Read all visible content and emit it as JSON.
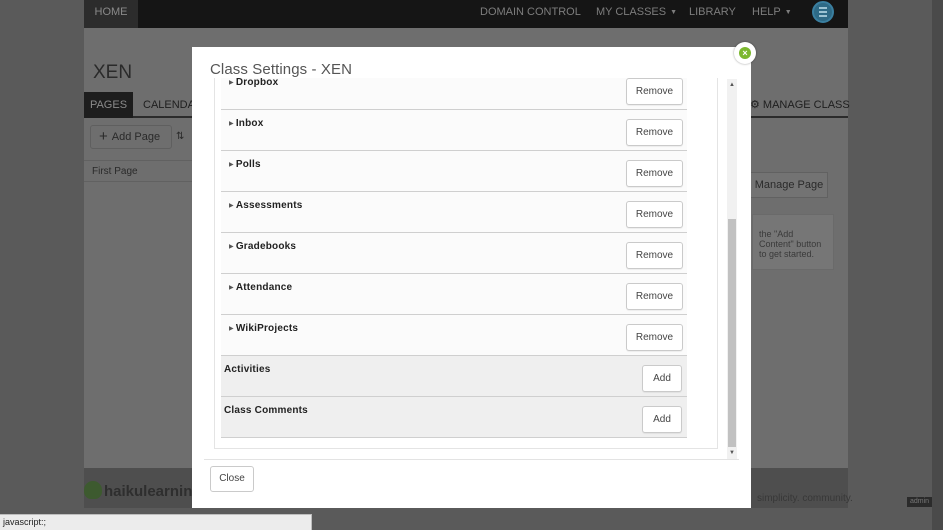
{
  "background": {
    "topnav": {
      "home": "HOME",
      "domain_control": "DOMAIN CONTROL",
      "my_classes": "MY CLASSES",
      "library": "LIBRARY",
      "help": "HELP"
    },
    "class_title": "XEN",
    "tabs": {
      "pages": "PAGES",
      "calendar": "CALENDAR",
      "manage_class": "MANAGE CLASS"
    },
    "add_page": "Add Page",
    "first_page": "First Page",
    "manage_page": "Manage Page",
    "hint": "the \"Add Content\" button to get started.",
    "logo_text": "haikulearning",
    "tagline": "simplicity. community.",
    "admin_badge": "admin",
    "status_text": "javascript:;"
  },
  "modal": {
    "title": "Class Settings - XEN",
    "remove_label": "Remove",
    "add_label": "Add",
    "close_label": "Close",
    "installed_rows": [
      {
        "label": "Dropbox"
      },
      {
        "label": "Inbox"
      },
      {
        "label": "Polls"
      },
      {
        "label": "Assessments"
      },
      {
        "label": "Gradebooks"
      },
      {
        "label": "Attendance"
      },
      {
        "label": "WikiProjects"
      }
    ],
    "available_rows": [
      {
        "label": "Activities"
      },
      {
        "label": "Class Comments"
      }
    ]
  },
  "colors": {
    "overlay": "#5a5a5a",
    "close_icon": "#7cb82f",
    "row_gray": "#efefef"
  }
}
